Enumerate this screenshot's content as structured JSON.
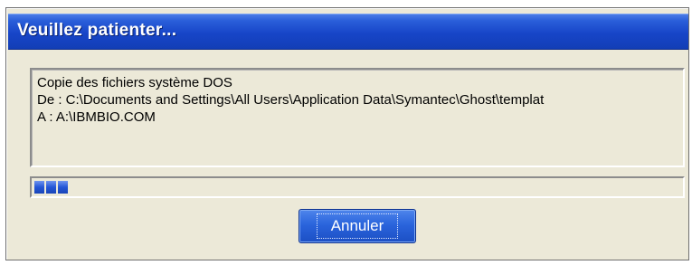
{
  "window": {
    "title": "Veuillez patienter..."
  },
  "info": {
    "line1": "Copie des fichiers système DOS",
    "line2": "De : C:\\Documents and Settings\\All Users\\Application Data\\Symantec\\Ghost\\templat",
    "line3": "A : A:\\IBMBIO.COM"
  },
  "progress": {
    "value_fraction": 0.05
  },
  "buttons": {
    "cancel_label": "Annuler"
  },
  "colors": {
    "titlebar": "#1745c8",
    "dialog_background": "#ece9d8",
    "progress_fill": "#2456d6",
    "button": "#2a64dc"
  }
}
